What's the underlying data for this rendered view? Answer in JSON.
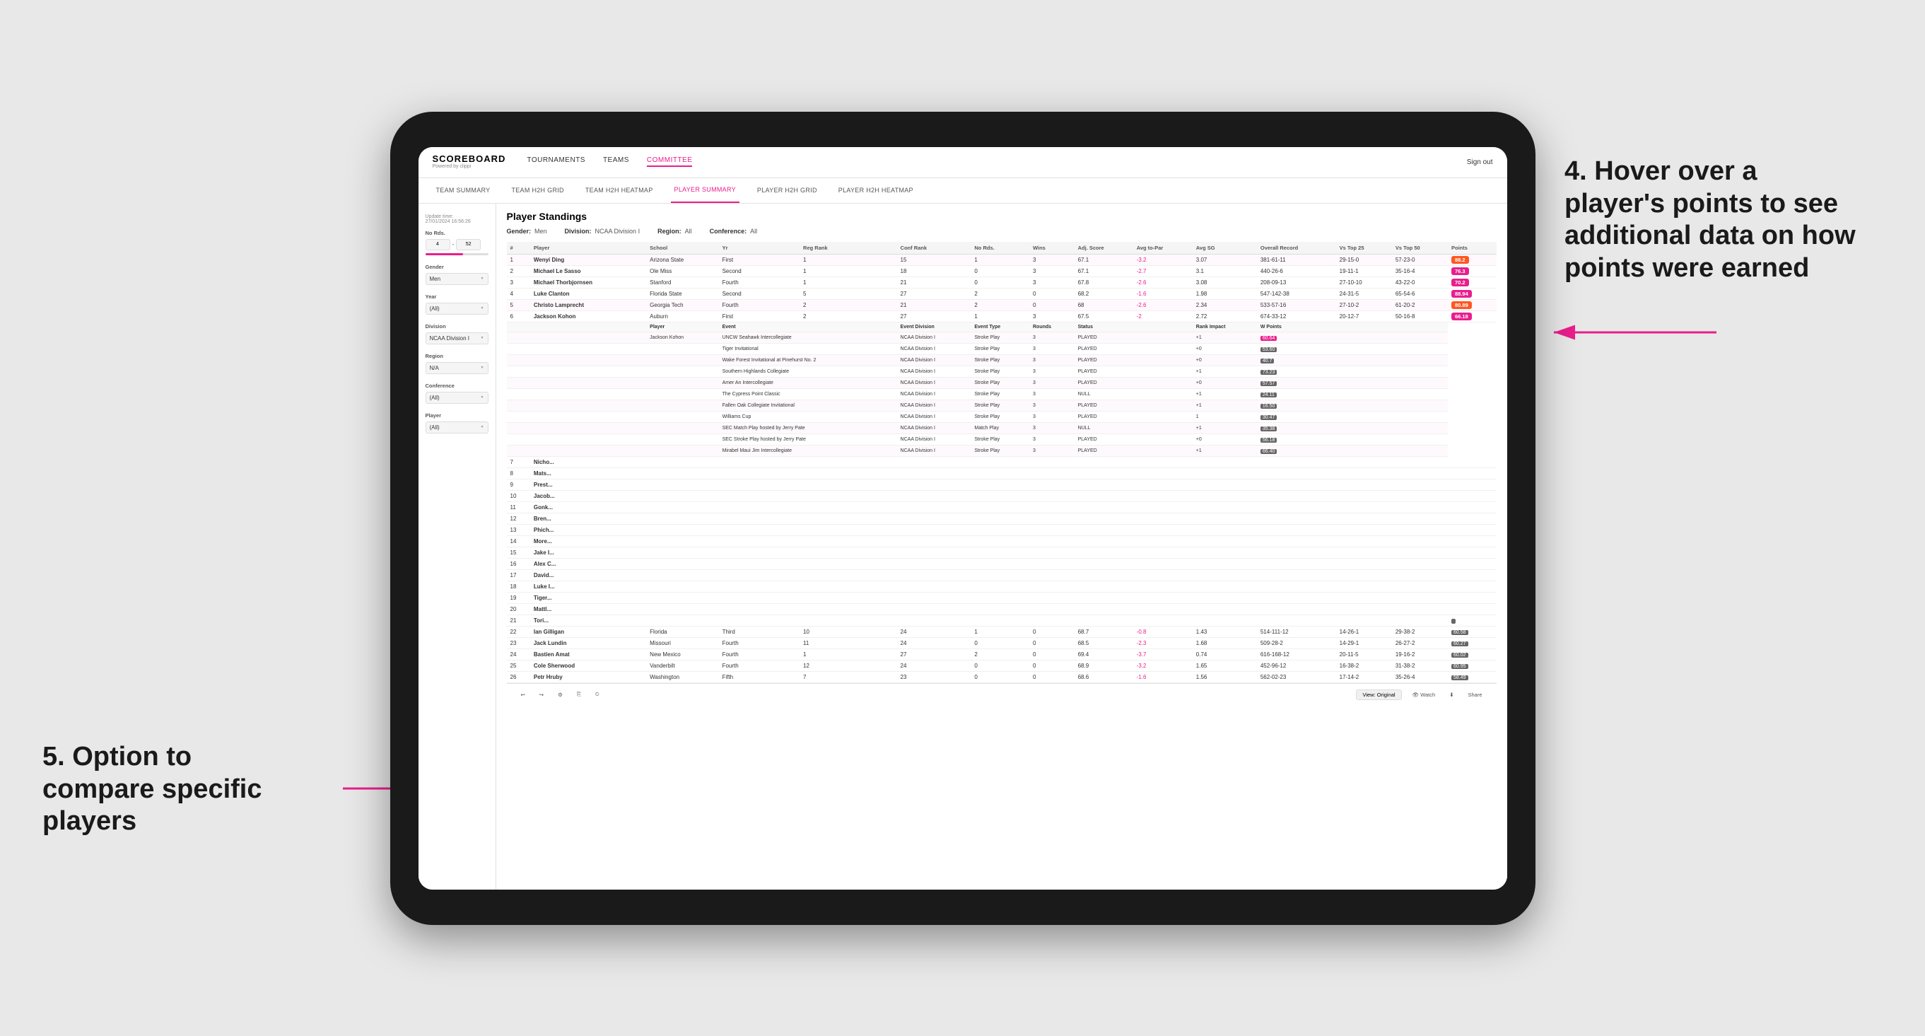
{
  "app": {
    "logo": "SCOREBOARD",
    "logo_sub": "Powered by clippi",
    "sign_out": "Sign out"
  },
  "nav": {
    "items": [
      {
        "label": "TOURNAMENTS",
        "active": false
      },
      {
        "label": "TEAMS",
        "active": false
      },
      {
        "label": "COMMITTEE",
        "active": true
      }
    ]
  },
  "sub_nav": {
    "items": [
      {
        "label": "TEAM SUMMARY",
        "active": false
      },
      {
        "label": "TEAM H2H GRID",
        "active": false
      },
      {
        "label": "TEAM H2H HEATMAP",
        "active": false
      },
      {
        "label": "PLAYER SUMMARY",
        "active": true
      },
      {
        "label": "PLAYER H2H GRID",
        "active": false
      },
      {
        "label": "PLAYER H2H HEATMAP",
        "active": false
      }
    ]
  },
  "sidebar": {
    "update_time_label": "Update time:",
    "update_time": "27/01/2024 16:56:26",
    "no_rds_label": "No Rds.",
    "no_rds_min": "4",
    "no_rds_max": "52",
    "gender_label": "Gender",
    "gender_value": "Men",
    "year_label": "Year",
    "year_value": "(All)",
    "division_label": "Division",
    "division_value": "NCAA Division I",
    "region_label": "Region",
    "region_value": "N/A",
    "conference_label": "Conference",
    "conference_value": "(All)",
    "player_label": "Player",
    "player_value": "(All)"
  },
  "standings": {
    "title": "Player Standings",
    "gender_label": "Gender:",
    "gender_value": "Men",
    "division_label": "Division:",
    "division_value": "NCAA Division I",
    "region_label": "Region:",
    "region_value": "All",
    "conference_label": "Conference:",
    "conference_value": "All",
    "columns": [
      "#",
      "Player",
      "School",
      "Yr",
      "Reg Rank",
      "Conf Rank",
      "No Rds.",
      "Wins",
      "Adj. Score",
      "Avg to-Par",
      "Avg SG",
      "Overall Record",
      "Vs Top 25",
      "Vs Top 50",
      "Points"
    ],
    "players": [
      {
        "rank": 1,
        "name": "Wenyi Ding",
        "school": "Arizona State",
        "yr": "First",
        "reg_rank": 1,
        "conf_rank": 15,
        "no_rds": 1,
        "wins": 3,
        "adj_score": 67.1,
        "avg_to_par": -3.2,
        "avg_sg": 3.07,
        "overall": "381-61-11",
        "vs_top25": "29-15-0",
        "vs_top50": "57-23-0",
        "points": "88.2",
        "highlight": true
      },
      {
        "rank": 2,
        "name": "Michael Le Sasso",
        "school": "Ole Miss",
        "yr": "Second",
        "reg_rank": 1,
        "conf_rank": 18,
        "no_rds": 0,
        "wins": 3,
        "adj_score": 67.1,
        "avg_to_par": -2.7,
        "avg_sg": 3.1,
        "overall": "440-26-6",
        "vs_top25": "19-11-1",
        "vs_top50": "35-16-4",
        "points": "76.3",
        "highlight": false
      },
      {
        "rank": 3,
        "name": "Michael Thorbjornsen",
        "school": "Stanford",
        "yr": "Fourth",
        "reg_rank": 1,
        "conf_rank": 21,
        "no_rds": 0,
        "wins": 3,
        "adj_score": 67.8,
        "avg_to_par": -2.6,
        "avg_sg": 3.08,
        "overall": "208-09-13",
        "vs_top25": "27-10-10",
        "vs_top50": "43-22-0",
        "points": "70.2",
        "highlight": false
      },
      {
        "rank": 4,
        "name": "Luke Clanton",
        "school": "Florida State",
        "yr": "Second",
        "reg_rank": 5,
        "conf_rank": 27,
        "no_rds": 2,
        "wins": 0,
        "adj_score": 68.2,
        "avg_to_par": -1.6,
        "avg_sg": 1.98,
        "overall": "547-142-38",
        "vs_top25": "24-31-5",
        "vs_top50": "65-54-6",
        "points": "88.94",
        "highlight": false
      },
      {
        "rank": 5,
        "name": "Christo Lamprecht",
        "school": "Georgia Tech",
        "yr": "Fourth",
        "reg_rank": 2,
        "conf_rank": 21,
        "no_rds": 2,
        "wins": 0,
        "adj_score": 68.0,
        "avg_to_par": -2.6,
        "avg_sg": 2.34,
        "overall": "533-57-16",
        "vs_top25": "27-10-2",
        "vs_top50": "61-20-2",
        "points": "80.89",
        "highlight": true
      },
      {
        "rank": 6,
        "name": "Jackson Kohon",
        "school": "Auburn",
        "yr": "First",
        "reg_rank": 2,
        "conf_rank": 27,
        "no_rds": 1,
        "wins": 3,
        "adj_score": 67.5,
        "avg_to_par": -2.0,
        "avg_sg": 2.72,
        "overall": "674-33-12",
        "vs_top25": "20-12-7",
        "vs_top50": "50-16-8",
        "points": "66.18",
        "highlight": false
      }
    ],
    "tooltip_columns": [
      "Player",
      "Event",
      "Event Division",
      "Event Type",
      "Rounds",
      "Status",
      "Rank Impact",
      "W Points"
    ],
    "tooltip_rows": [
      {
        "player": "Jackson Kohon",
        "event": "UNCW Seahawk Intercollegiate",
        "division": "NCAA Division I",
        "type": "Stroke Play",
        "rounds": 3,
        "status": "PLAYED",
        "rank_impact": "+1",
        "w_points": "60.64"
      },
      {
        "player": "",
        "event": "Tiger Invitational",
        "division": "NCAA Division I",
        "type": "Stroke Play",
        "rounds": 3,
        "status": "PLAYED",
        "rank_impact": "+0",
        "w_points": "53.60"
      },
      {
        "player": "",
        "event": "Wake Forest Invitational at Pinehurst No. 2",
        "division": "NCAA Division I",
        "type": "Stroke Play",
        "rounds": 3,
        "status": "PLAYED",
        "rank_impact": "+0",
        "w_points": "40.7"
      },
      {
        "player": "",
        "event": "Southern Highlands Collegiate",
        "division": "NCAA Division I",
        "type": "Stroke Play",
        "rounds": 3,
        "status": "PLAYED",
        "rank_impact": "+1",
        "w_points": "73.23"
      },
      {
        "player": "",
        "event": "Amer An Intercollegiate",
        "division": "NCAA Division I",
        "type": "Stroke Play",
        "rounds": 3,
        "status": "PLAYED",
        "rank_impact": "+0",
        "w_points": "57.57"
      },
      {
        "player": "",
        "event": "The Cypress Point Classic",
        "division": "NCAA Division I",
        "type": "Stroke Play",
        "rounds": 3,
        "status": "NULL",
        "rank_impact": "+1",
        "w_points": "24.11"
      },
      {
        "player": "",
        "event": "Fallen Oak Collegiate Invitational",
        "division": "NCAA Division I",
        "type": "Stroke Play",
        "rounds": 3,
        "status": "PLAYED",
        "rank_impact": "+1",
        "w_points": "16.50"
      },
      {
        "player": "",
        "event": "Williams Cup",
        "division": "NCAA Division I",
        "type": "Stroke Play",
        "rounds": 3,
        "status": "PLAYED",
        "rank_impact": "1",
        "w_points": "30.47"
      },
      {
        "player": "",
        "event": "SEC Match Play hosted by Jerry Pate",
        "division": "NCAA Division I",
        "type": "Match Play",
        "rounds": 3,
        "status": "NULL",
        "rank_impact": "+1",
        "w_points": "35.38"
      },
      {
        "player": "",
        "event": "SEC Stroke Play hosted by Jerry Pate",
        "division": "NCAA Division I",
        "type": "Stroke Play",
        "rounds": 3,
        "status": "PLAYED",
        "rank_impact": "+0",
        "w_points": "56.18"
      },
      {
        "player": "",
        "event": "Mirabel Maui Jim Intercollegiate",
        "division": "NCAA Division I",
        "type": "Stroke Play",
        "rounds": 3,
        "status": "PLAYED",
        "rank_impact": "+1",
        "w_points": "66.40"
      }
    ],
    "extra_players": [
      {
        "rank": 21,
        "name": "Tori...",
        "school": "",
        "yr": "",
        "reg_rank": "",
        "conf_rank": "",
        "no_rds": "",
        "wins": "",
        "adj_score": "",
        "avg_to_par": "",
        "avg_sg": "",
        "overall": "",
        "vs_top25": "",
        "vs_top50": "",
        "points": ""
      },
      {
        "rank": 22,
        "name": "Ian Gilligan",
        "school": "Florida",
        "yr": "Third",
        "reg_rank": 10,
        "conf_rank": 24,
        "no_rds": 1,
        "wins": 0,
        "adj_score": 68.7,
        "avg_to_par": -0.8,
        "avg_sg": 1.43,
        "overall": "514-111-12",
        "vs_top25": "14-26-1",
        "vs_top50": "29-38-2",
        "points": "60.58"
      },
      {
        "rank": 23,
        "name": "Jack Lundin",
        "school": "Missouri",
        "yr": "Fourth",
        "reg_rank": 11,
        "conf_rank": 24,
        "no_rds": 0,
        "wins": 0,
        "adj_score": 68.5,
        "avg_to_par": -2.3,
        "avg_sg": 1.68,
        "overall": "509-28-2",
        "vs_top25": "14-29-1",
        "vs_top50": "26-27-2",
        "points": "60.27"
      },
      {
        "rank": 24,
        "name": "Bastien Amat",
        "school": "New Mexico",
        "yr": "Fourth",
        "reg_rank": 1,
        "conf_rank": 27,
        "no_rds": 2,
        "wins": 0,
        "adj_score": 69.4,
        "avg_to_par": -3.7,
        "avg_sg": 0.74,
        "overall": "616-168-12",
        "vs_top25": "20-11-5",
        "vs_top50": "19-16-2",
        "points": "60.02"
      },
      {
        "rank": 25,
        "name": "Cole Sherwood",
        "school": "Vanderbilt",
        "yr": "Fourth",
        "reg_rank": 12,
        "conf_rank": 24,
        "no_rds": 0,
        "wins": 0,
        "adj_score": 68.9,
        "avg_to_par": -3.2,
        "avg_sg": 1.65,
        "overall": "452-96-12",
        "vs_top25": "16-38-2",
        "vs_top50": "31-38-2",
        "points": "60.95"
      },
      {
        "rank": 26,
        "name": "Petr Hruby",
        "school": "Washington",
        "yr": "Fifth",
        "reg_rank": 7,
        "conf_rank": 23,
        "no_rds": 0,
        "wins": 0,
        "adj_score": 68.6,
        "avg_to_par": -1.6,
        "avg_sg": 1.56,
        "overall": "562-02-23",
        "vs_top25": "17-14-2",
        "vs_top50": "35-26-4",
        "points": "58.49"
      }
    ]
  },
  "bottom_bar": {
    "undo": "↩",
    "redo": "↪",
    "view_original": "View: Original",
    "watch": "Watch",
    "share": "Share"
  },
  "annotations": {
    "right": "4. Hover over a player's points to see additional data on how points were earned",
    "left": "5. Option to compare specific players"
  }
}
